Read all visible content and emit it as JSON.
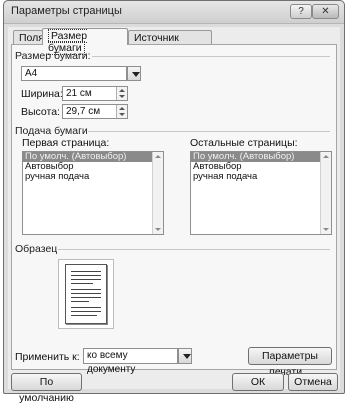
{
  "window": {
    "title": "Параметры страницы",
    "help_glyph": "?",
    "close_glyph": "✕"
  },
  "tabs": [
    {
      "label": "Поля",
      "active": false
    },
    {
      "label": "Размер бумаги",
      "active": true
    },
    {
      "label": "Источник бумаги",
      "active": false
    }
  ],
  "paper_size": {
    "group_label": "Размер бумаги:",
    "size_value": "A4",
    "width_label": "Ширина:",
    "width_value": "21 см",
    "height_label": "Высота:",
    "height_value": "29,7 см"
  },
  "paper_source": {
    "group_label": "Подача бумаги",
    "first_page_label": "Первая страница:",
    "other_pages_label": "Остальные страницы:",
    "first_page_items": [
      "По умолч. (Автовыбор)",
      "Автовыбор",
      "ручная подача"
    ],
    "other_pages_items": [
      "По умолч. (Автовыбор)",
      "Автовыбор",
      "ручная подача"
    ],
    "selected_index": 0
  },
  "preview": {
    "group_label": "Образец"
  },
  "apply": {
    "label": "Применить к:",
    "value": "ко всему документу"
  },
  "buttons": {
    "print_options": "Параметры печати...",
    "default": "По умолчанию",
    "ok": "ОК",
    "cancel": "Отмена"
  }
}
